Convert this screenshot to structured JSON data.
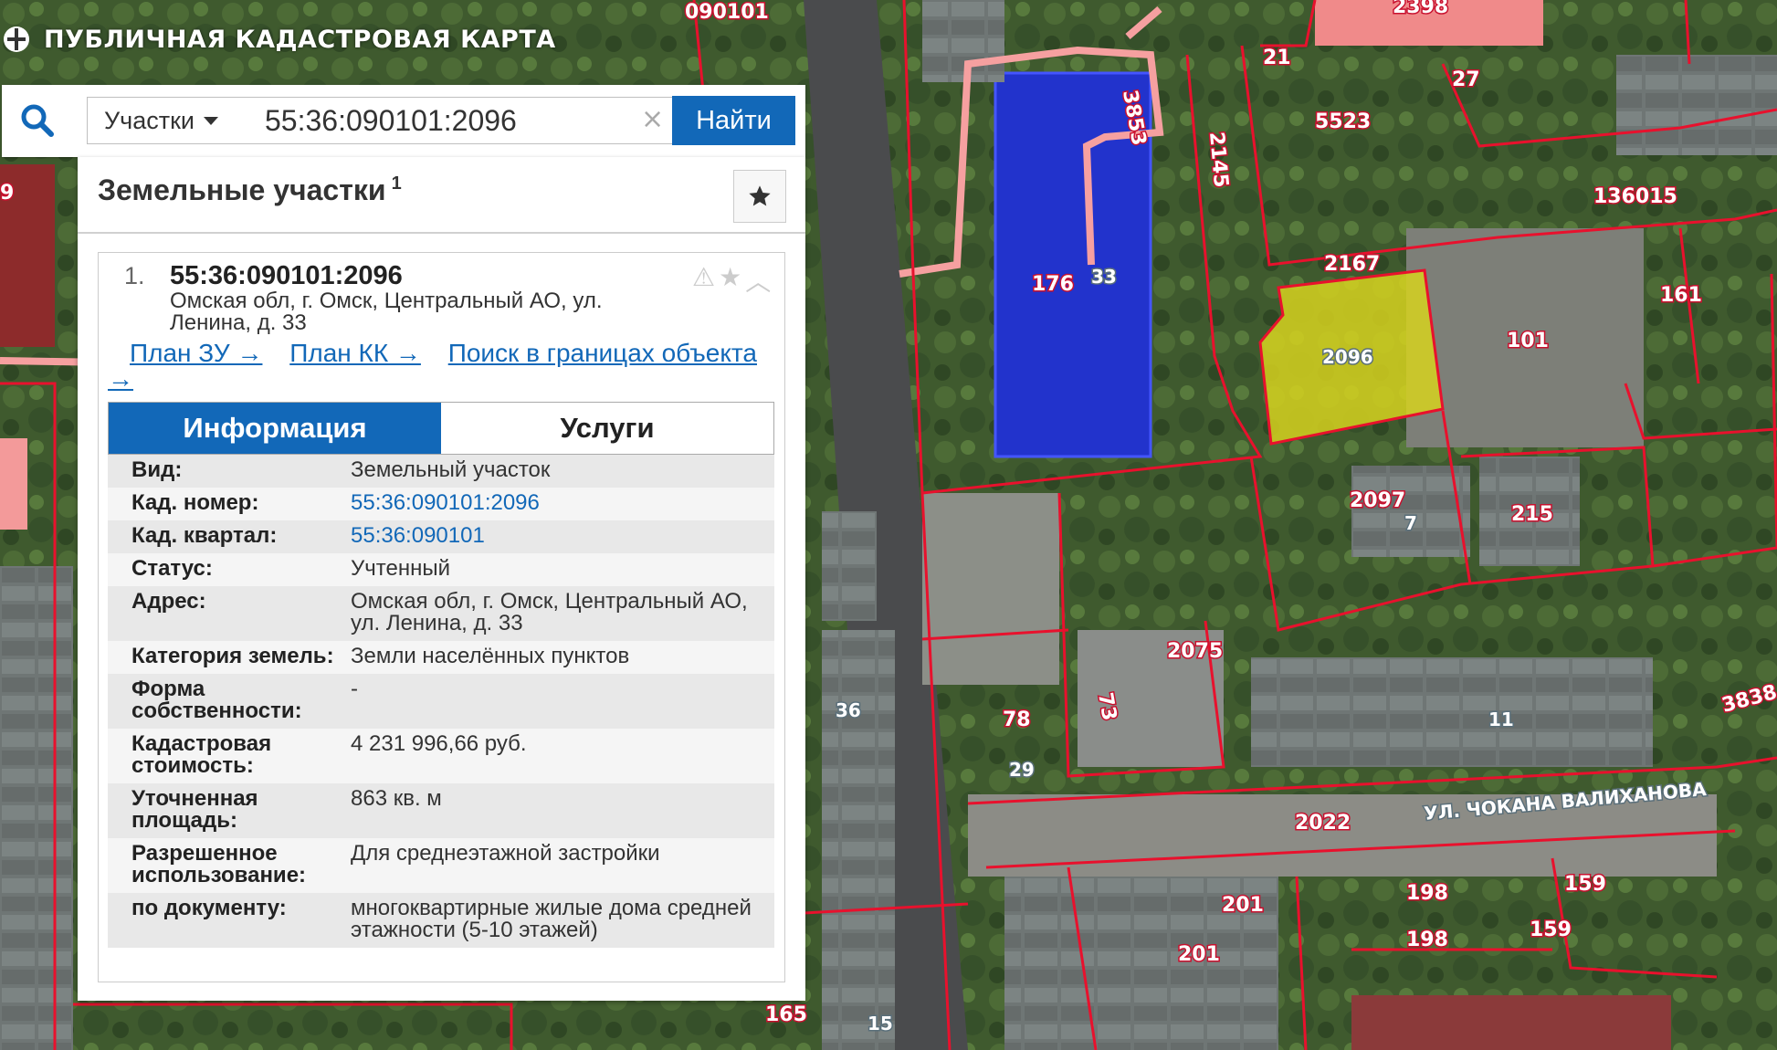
{
  "app": {
    "title": "ПУБЛИЧНАЯ КАДАСТРОВАЯ КАРТА"
  },
  "search": {
    "type_label": "Участки",
    "value": "55:36:090101:2096",
    "clear_symbol": "×",
    "button_label": "Найти"
  },
  "panel": {
    "title": "Земельные участки",
    "count": "1",
    "favorite_icon": "star-icon"
  },
  "result": {
    "number": "1.",
    "cad_number": "55:36:090101:2096",
    "address": "Омская обл, г. Омск, Центральный АО, ул. Ленина, д. 33",
    "links": {
      "plan_zu": "План ЗУ →",
      "plan_kk": "План КК →",
      "search_in_bounds": "Поиск в границах объекта →"
    },
    "tabs": [
      {
        "label": "Информация",
        "active": true
      },
      {
        "label": "Услуги",
        "active": false
      }
    ]
  },
  "info": [
    {
      "key": "Вид:",
      "value": "Земельный участок",
      "link": false
    },
    {
      "key": "Кад. номер:",
      "value": "55:36:090101:2096",
      "link": true
    },
    {
      "key": "Кад. квартал:",
      "value": "55:36:090101",
      "link": true
    },
    {
      "key": "Статус:",
      "value": "Учтенный",
      "link": false
    },
    {
      "key": "Адрес:",
      "value": "Омская обл, г. Омск, Центральный АО, ул. Ленина, д. 33",
      "link": false
    },
    {
      "key": "Категория земель:",
      "value": "Земли населённых пунктов",
      "link": false
    },
    {
      "key": "Форма собственности:",
      "value": "-",
      "link": false
    },
    {
      "key": "Кадастровая стоимость:",
      "value": "4 231 996,66 руб.",
      "link": false
    },
    {
      "key": "Уточненная площадь:",
      "value": "863 кв. м",
      "link": false
    },
    {
      "key": "Разрешенное использование:",
      "value": "Для среднеэтажной застройки",
      "link": false
    },
    {
      "key": "по документу:",
      "value": "многоквартирные жилые дома средней этажности (5-10 этажей)",
      "link": false
    }
  ],
  "map": {
    "quarter_label": "090101",
    "street_label": "УЛ. ЧОКАНА ВАЛИХАНОВА",
    "parcel_labels": [
      "2398",
      "21",
      "27",
      "5523",
      "136015",
      "3853",
      "2145",
      "176",
      "2167",
      "2096",
      "161",
      "101",
      "2097",
      "215",
      "2075",
      "3838",
      "78",
      "73",
      "2022",
      "201",
      "201",
      "198",
      "198",
      "159",
      "159",
      "165",
      "9",
      "7",
      "11",
      "33",
      "36",
      "29",
      "15"
    ],
    "colors": {
      "parcel_border": "#e8112d",
      "selected_fill": "#d6d21e",
      "building_blue": "#2233cc",
      "street_line": "#f6a0a0"
    }
  }
}
